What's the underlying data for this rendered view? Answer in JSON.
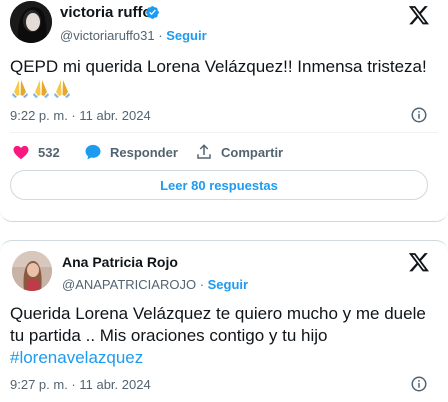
{
  "tweets": [
    {
      "author": {
        "name": "victoria ruffo",
        "handle": "@victoriaruffo31",
        "verified": true
      },
      "follow_label": "Seguir",
      "text": "QEPD mi querida Lorena Velázquez!! Inmensa tristeza!",
      "emoji": [
        "folded-hands",
        "folded-hands",
        "folded-hands"
      ],
      "timestamp": "9:22 p. m. · 11 abr. 2024",
      "likes": "532",
      "reply_label": "Responder",
      "share_label": "Compartir",
      "read_replies_label": "Leer 80 respuestas"
    },
    {
      "author": {
        "name": "Ana Patricia Rojo",
        "handle": "@ANAPATRICIAROJO",
        "verified": false
      },
      "follow_label": "Seguir",
      "text": "Querida Lorena Velázquez te quiero mucho y me duele tu partida .. Mis oraciones contigo y tu hijo",
      "hashtag": "#lorenavelazquez",
      "timestamp": "9:27 p. m. · 11 abr. 2024"
    }
  ],
  "colors": {
    "accent": "#1d9bf0",
    "like": "#f91880",
    "muted": "#536471",
    "text": "#0f1419",
    "border": "#cfd9de"
  }
}
